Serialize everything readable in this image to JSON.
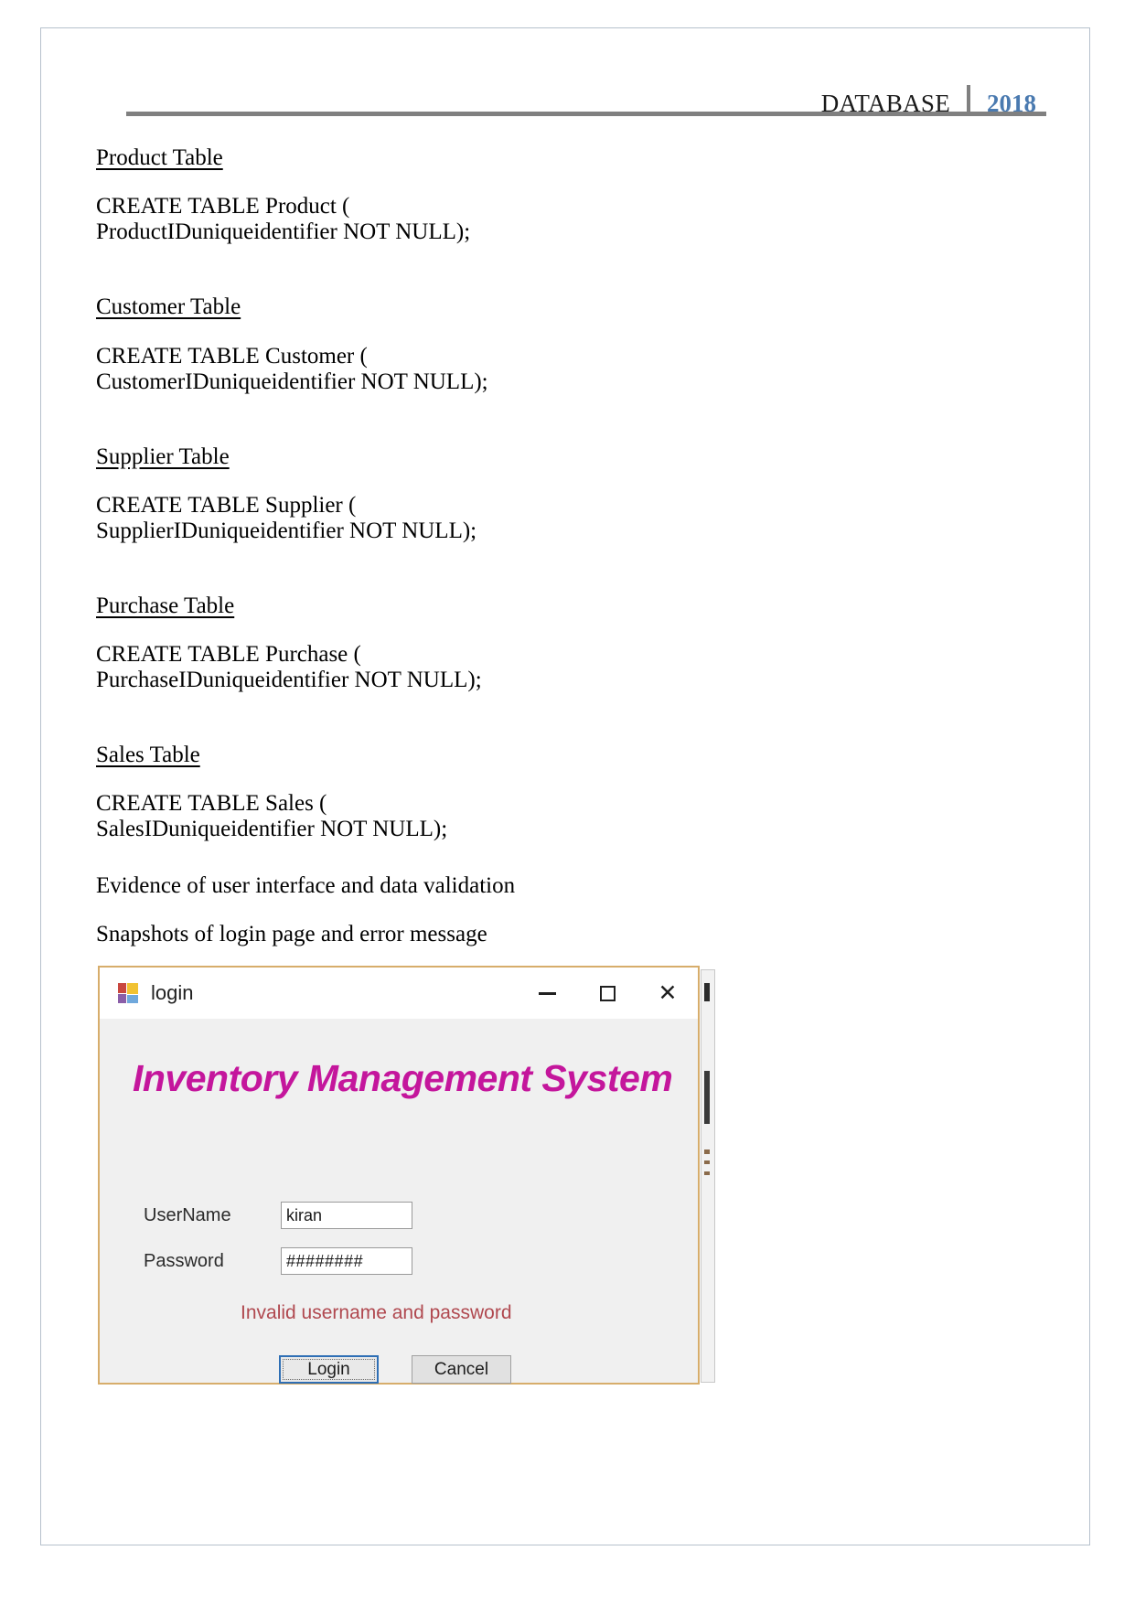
{
  "header": {
    "title": "DATABASE",
    "year": "2018"
  },
  "sections": [
    {
      "heading": "Product Table",
      "sql_lines": [
        "CREATE TABLE Product (",
        "ProductIDuniqueidentifier NOT NULL);"
      ]
    },
    {
      "heading": "Customer Table",
      "sql_lines": [
        "CREATE TABLE Customer (",
        "CustomerIDuniqueidentifier NOT NULL);"
      ]
    },
    {
      "heading": "Supplier Table",
      "sql_lines": [
        "CREATE TABLE Supplier (",
        "SupplierIDuniqueidentifier NOT NULL);"
      ]
    },
    {
      "heading": "Purchase Table",
      "sql_lines": [
        "CREATE TABLE Purchase (",
        "PurchaseIDuniqueidentifier NOT NULL);"
      ]
    },
    {
      "heading": "Sales Table",
      "sql_lines": [
        "CREATE TABLE Sales (",
        "SalesIDuniqueidentifier NOT NULL);"
      ]
    }
  ],
  "body_lines": {
    "evidence": "Evidence of user interface and data validation",
    "snapshots": "Snapshots of login page and error message"
  },
  "login_dialog": {
    "window_title": "login",
    "app_icon": "winforms-app-icon",
    "controls": {
      "minimize": "minimize-icon",
      "maximize": "maximize-icon",
      "close": "close-icon"
    },
    "app_heading": "Inventory Management System",
    "fields": [
      {
        "label": "UserName",
        "value": "kiran",
        "placeholder": ""
      },
      {
        "label": "Password",
        "value": "########",
        "placeholder": ""
      }
    ],
    "error_message": "Invalid username and password",
    "buttons": {
      "login": "Login",
      "cancel": "Cancel"
    }
  },
  "colors": {
    "header_year": "#4a7ab0",
    "header_rule": "#808080",
    "page_border": "#b6c1cc",
    "app_heading": "#c4169c",
    "error_text": "#b0484f",
    "dialog_border": "#d7ad6b",
    "primary_button_border": "#2f6fb5"
  }
}
